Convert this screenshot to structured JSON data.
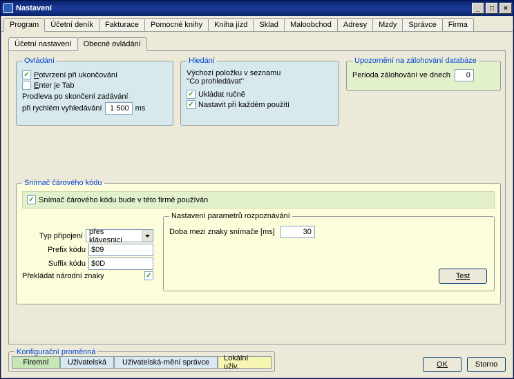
{
  "title": "Nastavení",
  "main_tabs": [
    "Program",
    "Účetní deník",
    "Fakturace",
    "Pomocné knihy",
    "Kniha jízd",
    "Sklad",
    "Maloobchod",
    "Adresy",
    "Mzdy",
    "Správce",
    "Firma"
  ],
  "main_tab_selected": 0,
  "sub_tabs": [
    "Účetní nastavení",
    "Obecné ovládání"
  ],
  "sub_tab_selected": 1,
  "ovladani": {
    "legend": "Ovládání",
    "confirm_on_exit": {
      "label": "Potvrzení při ukončování",
      "checked": true
    },
    "enter_is_tab": {
      "label": "Enter je Tab",
      "checked": false
    },
    "delay_label_1": "Prodleva po skončení zadávání",
    "delay_label_2": "při rychlém vyhledávání",
    "delay_value": "1 500",
    "delay_unit": "ms"
  },
  "hledani": {
    "legend": "Hledání",
    "intro1": "Výchozí položku v seznamu",
    "intro2": "''Co prohledávat''",
    "save_manual": {
      "label": "Ukládat ručně",
      "checked": true
    },
    "set_each_use": {
      "label": "Nastavit při každém použití",
      "checked": true
    }
  },
  "upoz": {
    "legend": "Upozornění na zálohování databáze",
    "label": "Perioda zálohování ve dnech",
    "value": "0"
  },
  "scanner": {
    "legend": "Snímač čárového kódu",
    "use_scanner": {
      "label": "Snímač čárového kódu bude v této firmě používán",
      "checked": true
    },
    "conn_type_label": "Typ připojení",
    "conn_type_value": "přes klávesnici",
    "prefix_label": "Prefix kódu",
    "prefix_value": "$09",
    "suffix_label": "Suffix kódu",
    "suffix_value": "$0D",
    "translate": {
      "label": "Překládat národní znaky",
      "checked": true
    },
    "params_legend": "Nastavení parametrů rozpoznávání",
    "interval_label": "Doba mezi znaky snímače [ms]",
    "interval_value": "30",
    "test_btn": "Test"
  },
  "konfig": {
    "legend": "Konfigurační proměnná",
    "firemni": "Firemní",
    "uzivatelska": "Uživatelská",
    "uziv_spravce": "Uživatelská-mění správce",
    "lokalni": "Lokální uživ."
  },
  "buttons": {
    "ok": "OK",
    "storno": "Storno"
  }
}
